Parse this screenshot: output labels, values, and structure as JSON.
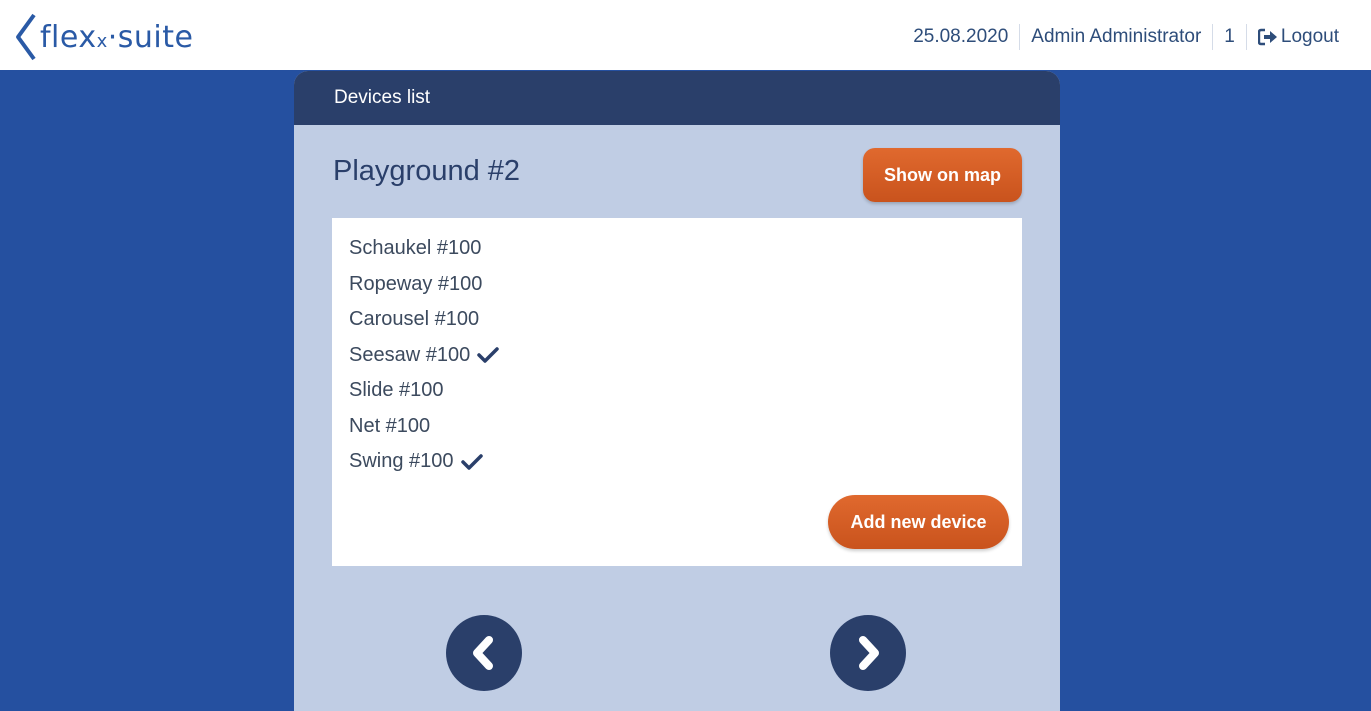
{
  "header": {
    "logo_text": "flex",
    "logo_x": "x",
    "logo_suite": "·suite",
    "date": "25.08.2020",
    "user": "Admin Administrator",
    "count": "1",
    "logout_label": "Logout"
  },
  "panel": {
    "header_title": "Devices list",
    "title": "Playground #2",
    "show_map_label": "Show on map",
    "add_device_label": "Add new device",
    "devices": [
      {
        "label": "Schaukel #100",
        "checked": false
      },
      {
        "label": "Ropeway #100",
        "checked": false
      },
      {
        "label": "Carousel #100",
        "checked": false
      },
      {
        "label": "Seesaw #100",
        "checked": true
      },
      {
        "label": "Slide #100",
        "checked": false
      },
      {
        "label": "Net #100",
        "checked": false
      },
      {
        "label": "Swing #100",
        "checked": true
      }
    ]
  },
  "colors": {
    "background": "#2550a0",
    "panel": "#c0cde4",
    "panel_header": "#2a3f6a",
    "accent": "#d85e25"
  },
  "icons": {
    "logout": "sign-out-icon",
    "check": "checkmark-icon",
    "prev": "chevron-left-icon",
    "next": "chevron-right-icon"
  }
}
